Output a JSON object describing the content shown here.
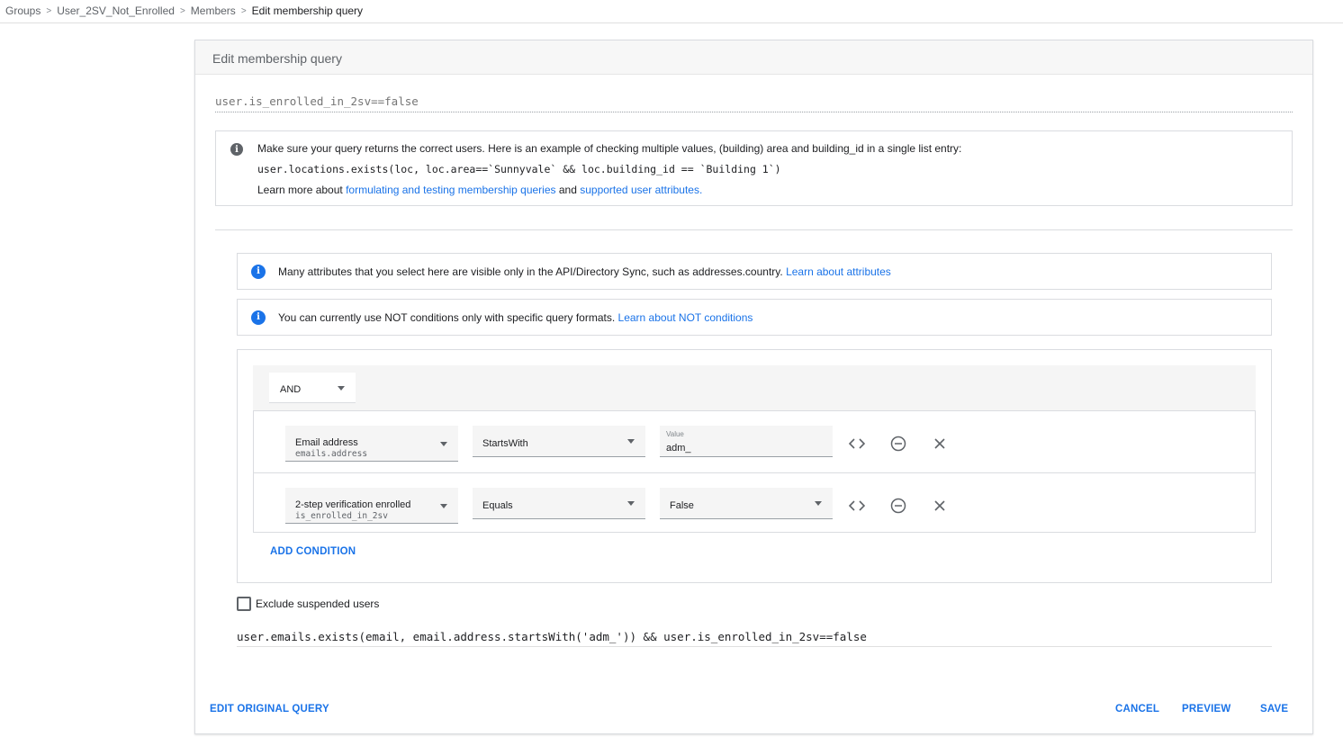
{
  "breadcrumb": {
    "items": [
      "Groups",
      "User_2SV_Not_Enrolled",
      "Members"
    ],
    "current": "Edit membership query",
    "separator": ">"
  },
  "card": {
    "title": "Edit membership query",
    "query_placeholder": "user.is_enrolled_in_2sv==false"
  },
  "help": {
    "icon_glyph": "i",
    "line1": "Make sure your query returns the correct users. Here is an example of checking multiple values, (building) area and building_id in a single list entry:",
    "code": "user.locations.exists(loc, loc.area==`Sunnyvale` && loc.building_id == `Building 1`)",
    "line3_prefix": "Learn more about ",
    "link1": "formulating and testing membership queries",
    "line3_mid": " and ",
    "link2": "supported user attributes."
  },
  "info_bars": [
    {
      "text": "Many attributes that you select here are visible only in the API/Directory Sync, such as addresses.country.",
      "link": "Learn about attributes"
    },
    {
      "text": "You can currently use NOT conditions only with specific query formats.",
      "link": "Learn about NOT conditions"
    }
  ],
  "builder": {
    "operator": "AND",
    "conditions": [
      {
        "attribute_label": "Email address",
        "attribute_key": "emails.address",
        "operator": "StartsWith",
        "value_label": "Value",
        "value": "adm_"
      },
      {
        "attribute_label": "2-step verification enrolled",
        "attribute_key": "is_enrolled_in_2sv",
        "operator": "Equals",
        "value": "False"
      }
    ],
    "add_condition_label": "ADD CONDITION"
  },
  "exclude_suspended": {
    "label": "Exclude suspended users",
    "checked": false
  },
  "final_query": "user.emails.exists(email, email.address.startsWith('adm_')) && user.is_enrolled_in_2sv==false",
  "footer": {
    "edit_original": "EDIT ORIGINAL QUERY",
    "cancel": "CANCEL",
    "preview": "PREVIEW",
    "save": "SAVE"
  },
  "colors": {
    "accent": "#1a73e8",
    "info_icon": "#1a73e8",
    "help_icon": "#5f6368"
  }
}
